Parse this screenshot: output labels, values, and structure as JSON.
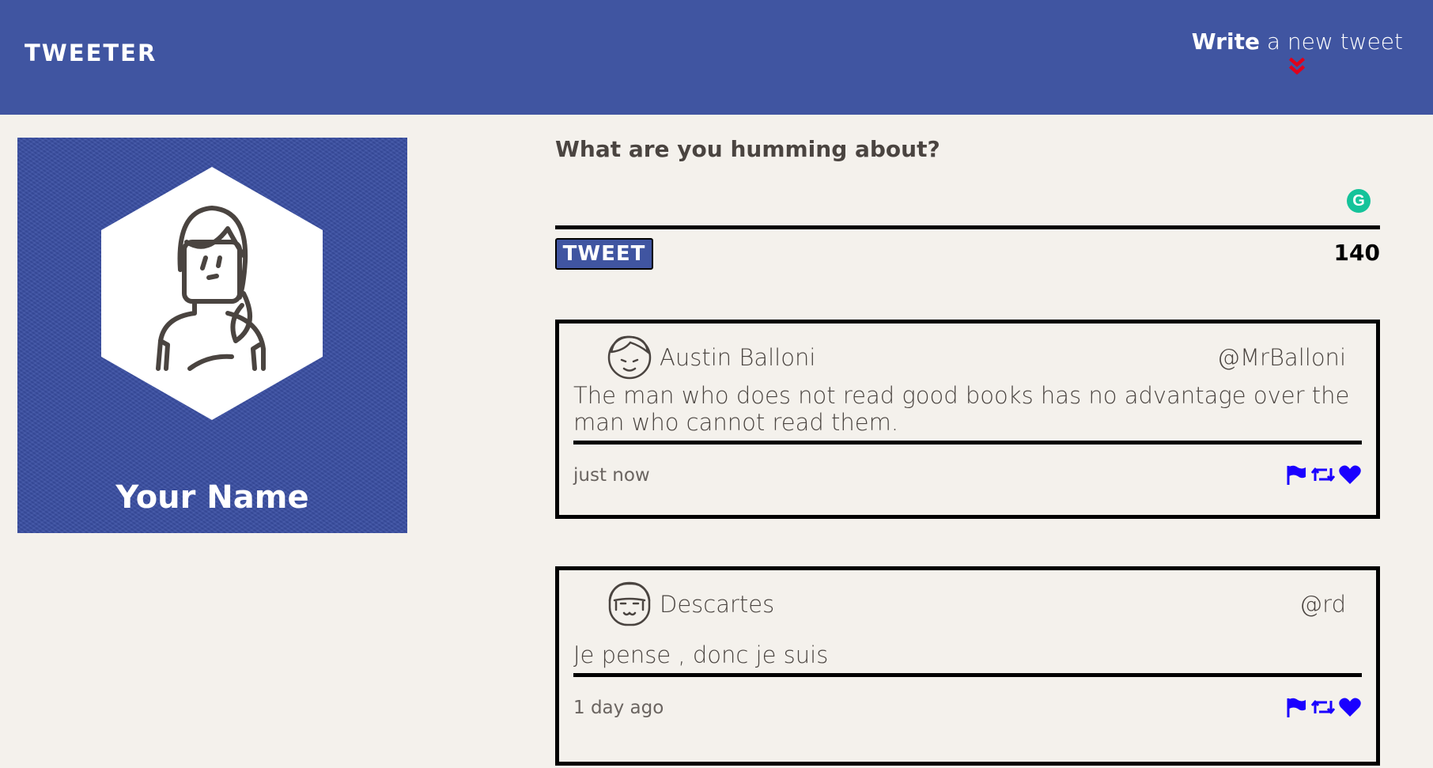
{
  "nav": {
    "brand": "TWEETER",
    "write_bold": "Write",
    "write_rest": " a new tweet",
    "chevron_icon": "double-chevron-down-icon",
    "chevron_color": "#e0001b"
  },
  "profile": {
    "name": "Your Name",
    "avatar_icon": "female-avatar-icon"
  },
  "compose": {
    "prompt": "What are you humming about?",
    "text_value": "",
    "button_label": "TWEET",
    "counter": "140"
  },
  "tweets": [
    {
      "user": "Austin Balloni",
      "handle": "@MrBalloni",
      "content": "The man who does not read good books has no advantage over the man who cannot read them.",
      "time": "just now"
    },
    {
      "user": "Descartes",
      "handle": "@rd",
      "content": "Je pense , donc je suis",
      "time": "1 day ago"
    }
  ],
  "colors": {
    "nav_bg": "#4055a1",
    "page_bg": "#f4f1ec",
    "action_icon": "#1a00ff"
  }
}
